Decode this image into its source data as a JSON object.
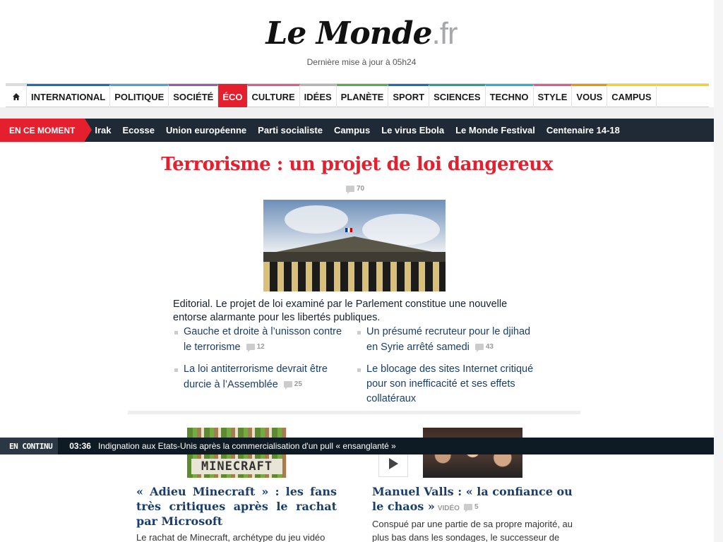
{
  "header": {
    "logo_main": "Le Monde",
    "logo_tld": ".fr",
    "update": "Dernière mise à jour à 05h24"
  },
  "nav": {
    "items": [
      {
        "label": "INTERNATIONAL",
        "color": "#1a6fb6"
      },
      {
        "label": "POLITIQUE",
        "color": "#46a6d8"
      },
      {
        "label": "SOCIÉTÉ",
        "color": "#9b58b5"
      },
      {
        "label": "ÉCO",
        "color": "#e4202f"
      },
      {
        "label": "CULTURE",
        "color": "#e85a86"
      },
      {
        "label": "IDÉES",
        "color": "#b4b4b4"
      },
      {
        "label": "PLANÈTE",
        "color": "#51b047"
      },
      {
        "label": "SPORT",
        "color": "#1a6fb6"
      },
      {
        "label": "SCIENCES",
        "color": "#17a89a"
      },
      {
        "label": "TECHNO",
        "color": "#27b3d6"
      },
      {
        "label": "STYLE",
        "color": "#e85a86"
      },
      {
        "label": "VOUS",
        "color": "#f39200"
      },
      {
        "label": "CAMPUS",
        "color": "#ffd400"
      }
    ],
    "active": "ÉCO"
  },
  "moment": {
    "label": "EN CE MOMENT",
    "items": [
      "Irak",
      "Ecosse",
      "Union européenne",
      "Parti socialiste",
      "Campus",
      "Le virus Ebola",
      "Le Monde Festival",
      "Centenaire 14-18"
    ]
  },
  "main": {
    "headline": "Terrorisme : un projet de loi dangereux",
    "comments": "70",
    "lead": "Editorial. Le projet de loi examiné par le Parlement constitue une nouvelle entorse alarmante pour les libertés publiques.",
    "related_left": [
      {
        "text": "Gauche et droite à l’unisson contre le terrorisme",
        "comments": "12"
      },
      {
        "text": "La loi antiterrorisme devrait être durcie à l’Assemblée",
        "comments": "25"
      }
    ],
    "related_right": [
      {
        "text": "Un présumé recruteur pour le djihad en Syrie arrêté samedi",
        "comments": "43"
      },
      {
        "text": "Le blocage des sites Internet critiqué pour son inefficacité et ses effets collatéraux",
        "comments": ""
      }
    ]
  },
  "articles": [
    {
      "title": "« Adieu Minecraft » : les fans très critiques après le rachat par Microsoft",
      "text": "Le rachat de Minecraft, archétype du jeu vidéo",
      "thumb_text": "MINECRAFT"
    },
    {
      "title": "Manuel Valls : « la confiance ou le chaos »",
      "video_tag": "VIDÉO",
      "comments": "5",
      "text": "Conspué par une partie de sa propre majorité, au plus bas dans les sondages, le successeur de"
    }
  ],
  "continu": {
    "label": "EN CONTINU",
    "time": "03:36",
    "text": "Indignation aux Etats-Unis après la commercialisation d'un pull « ensanglanté »"
  }
}
